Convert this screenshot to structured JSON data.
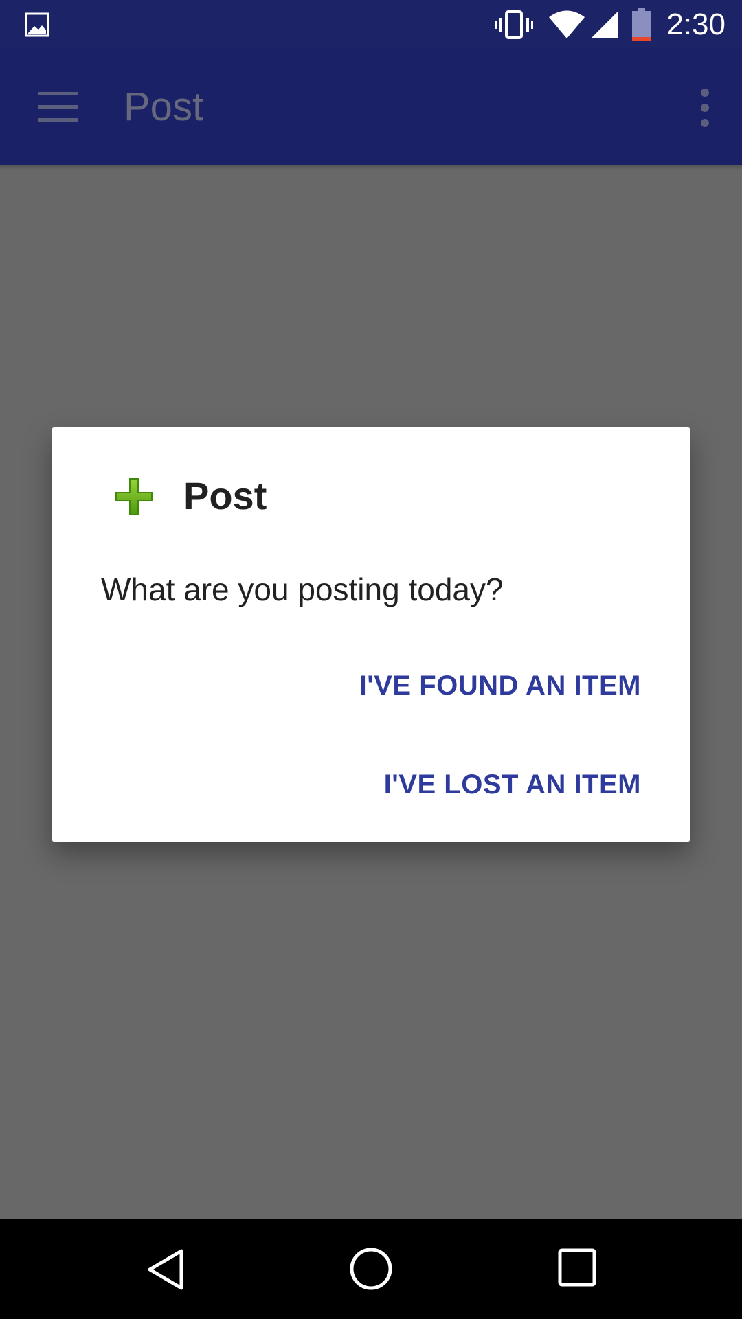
{
  "status_bar": {
    "time": "2:30",
    "icons": [
      "image-notification-icon",
      "vibrate-icon",
      "wifi-icon",
      "cell-signal-icon",
      "battery-icon"
    ],
    "battery_level": 0.1
  },
  "app_bar": {
    "title": "Post",
    "icons": [
      "menu-icon",
      "overflow-menu-icon"
    ],
    "background_color": "#1a2166"
  },
  "dialog": {
    "icon": "green-plus-icon",
    "title": "Post",
    "message": "What are you posting today?",
    "buttons": {
      "found": "I'VE FOUND AN ITEM",
      "lost": "I'VE LOST AN ITEM"
    },
    "accent_color": "#2e3b9c"
  },
  "nav_bar": {
    "icons": [
      "back-icon",
      "home-icon",
      "recent-apps-icon"
    ]
  }
}
